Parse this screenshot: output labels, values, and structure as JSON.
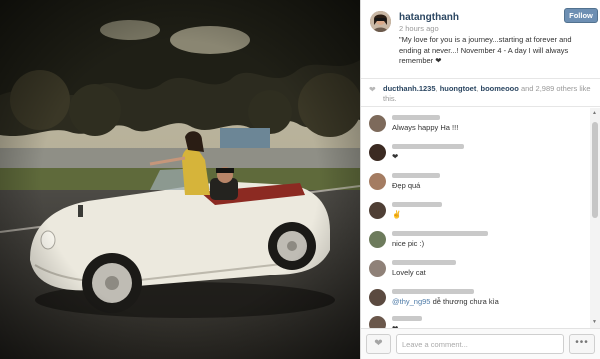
{
  "post": {
    "username": "hatangthanh",
    "time_ago": "2 hours ago",
    "caption": "\"My love for you is a journey...starting at forever and ending at never...! November 4 - A day I will always remember ❤",
    "follow_label": "Follow"
  },
  "likes": {
    "user1": "ducthanh.1235",
    "user2": "huongtoet",
    "user3": "boomeooo",
    "rest": "and 2,989 others like this."
  },
  "comments": [
    {
      "text": "Always happy Ha !!!"
    },
    {
      "text": "❤"
    },
    {
      "text": "Đẹp quá"
    },
    {
      "text": "✌"
    },
    {
      "text": "nice pic :)"
    },
    {
      "text": "Lovely cat"
    },
    {
      "mention": "@thy_ng95",
      "text": "dễ thương chưa kìa"
    },
    {
      "text": "❤"
    }
  ],
  "composer": {
    "placeholder": "Leave a comment...",
    "more_label": "•••"
  },
  "colors": {
    "follow_button": "#6d8fb3",
    "username": "#2c4762",
    "link": "#4d7aa7"
  },
  "icons": {
    "heart": "heart-icon",
    "more": "more-options-icon",
    "scroll_up": "scroll-up-arrow-icon",
    "scroll_down": "scroll-down-arrow-icon"
  }
}
